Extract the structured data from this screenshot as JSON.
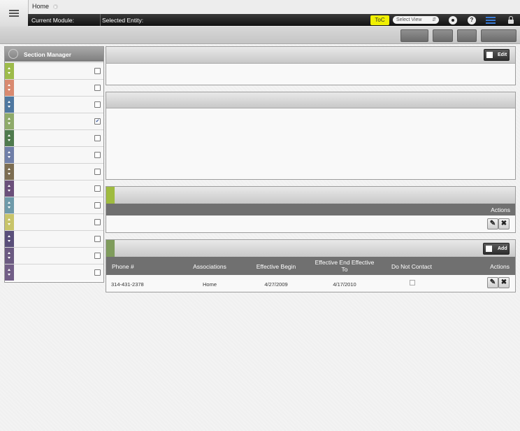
{
  "breadcrumb": {
    "home": "Home"
  },
  "header": {
    "current_module_label": "Current Module:",
    "selected_entity_label": "Selected Entity:",
    "toc_label": "ToC",
    "select_view": "Select View"
  },
  "section_manager": {
    "title": "Section Manager",
    "items": [
      {
        "color": "#9dbb4a",
        "checked": false
      },
      {
        "color": "#d98a70",
        "checked": false
      },
      {
        "color": "#4f78a0",
        "checked": false
      },
      {
        "color": "#8eaa6a",
        "checked": true
      },
      {
        "color": "#4f7a4d",
        "checked": false
      },
      {
        "color": "#707fa8",
        "checked": false
      },
      {
        "color": "#7c6d52",
        "checked": false
      },
      {
        "color": "#6b4f7a",
        "checked": false
      },
      {
        "color": "#6f9aaa",
        "checked": false
      },
      {
        "color": "#c8c46a",
        "checked": false
      },
      {
        "color": "#5a4f7a",
        "checked": false
      },
      {
        "color": "#6b5a82",
        "checked": false
      },
      {
        "color": "#725e87",
        "checked": false
      }
    ]
  },
  "panel1": {
    "edit_label": "Edit"
  },
  "panel3": {
    "actions_label": "Actions",
    "accent": "#9fbb3f"
  },
  "panel4": {
    "add_label": "Add",
    "accent": "#7f9c5c",
    "columns": {
      "phone": "Phone #",
      "associations": "Associations",
      "effective_begin": "Effective Begin",
      "effective_end": "Effective End Effective To",
      "do_not_contact": "Do Not Contact",
      "actions": "Actions"
    },
    "row": {
      "phone": "314-431-2378",
      "associations": "Home",
      "effective_begin": "4/27/2009",
      "effective_end": "4/17/2010",
      "do_not_contact": false
    }
  }
}
